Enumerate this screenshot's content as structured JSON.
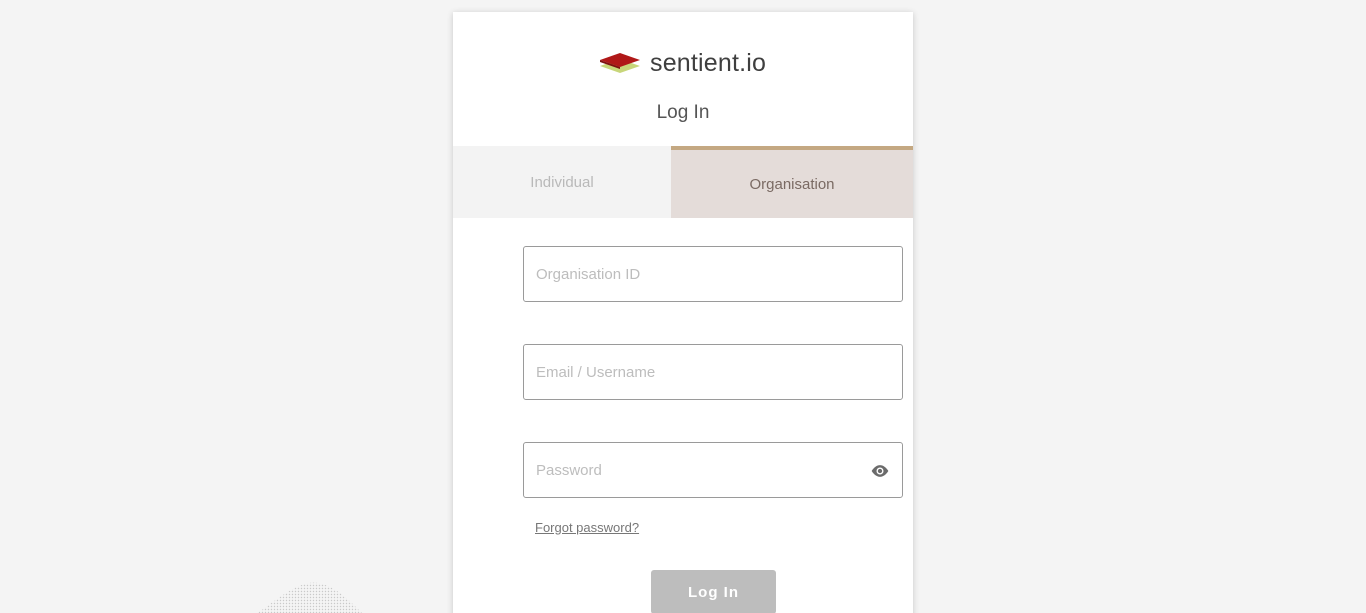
{
  "brand": {
    "name": "sentient.io",
    "logo_icon": "layered-diamond-logo",
    "colors": {
      "top": "#b01818",
      "bottom": "#c8d67a"
    }
  },
  "login": {
    "heading": "Log In",
    "tabs": [
      {
        "label": "Individual",
        "active": false
      },
      {
        "label": "Organisation",
        "active": true
      }
    ],
    "fields": {
      "organisation_id": {
        "placeholder": "Organisation ID",
        "value": ""
      },
      "email": {
        "placeholder": "Email / Username",
        "value": ""
      },
      "password": {
        "placeholder": "Password",
        "value": "",
        "toggle_icon": "eye-icon"
      }
    },
    "forgot_label": "Forgot password?",
    "submit_label": "Log In"
  },
  "theme": {
    "active_tab_bg": "#e4dcd9",
    "active_tab_accent": "#c4a882",
    "button_bg": "#bdbdbd",
    "page_bg": "#f4f4f4"
  }
}
